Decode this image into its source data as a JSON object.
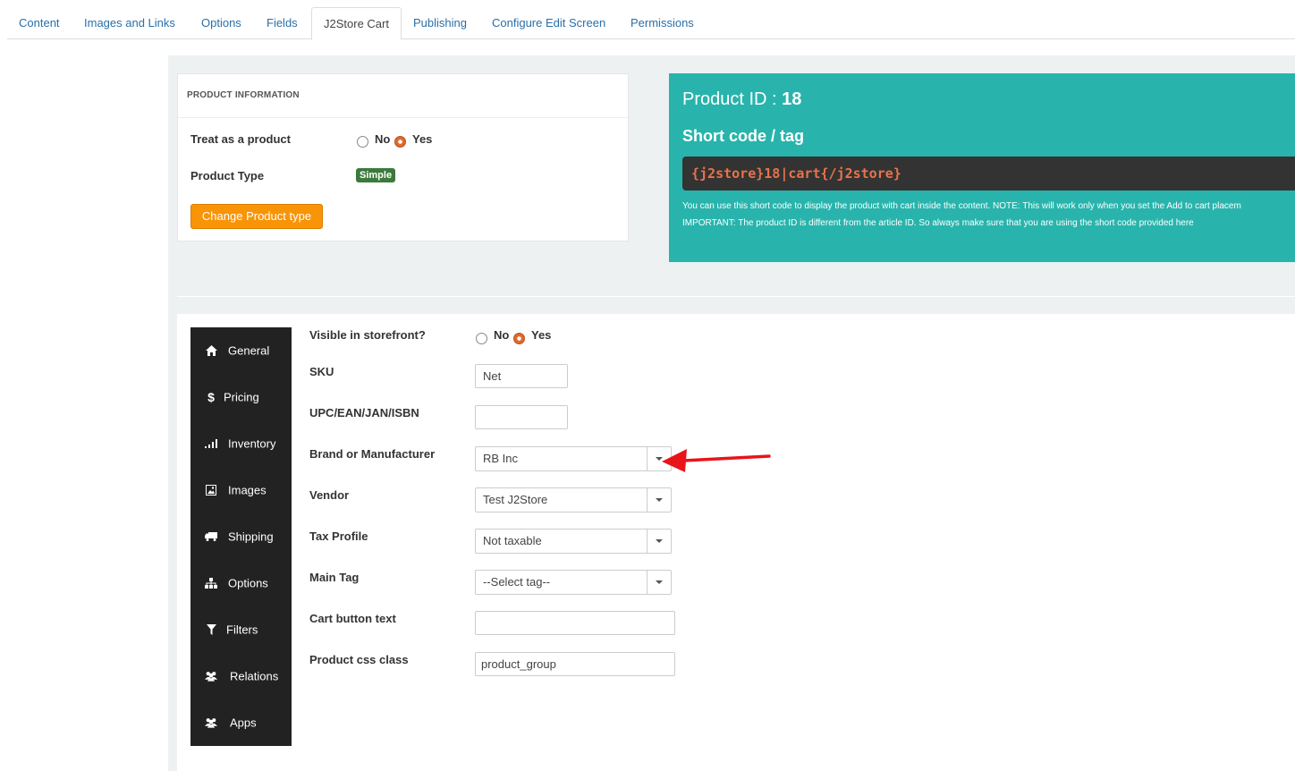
{
  "tabs": [
    "Content",
    "Images and Links",
    "Options",
    "Fields",
    "J2Store Cart",
    "Publishing",
    "Configure Edit Screen",
    "Permissions"
  ],
  "active_tab": "J2Store Cart",
  "product_info": {
    "heading": "PRODUCT INFORMATION",
    "treat_label": "Treat as a product",
    "no": "No",
    "yes": "Yes",
    "treat_value": "Yes",
    "type_label": "Product Type",
    "type_badge": "Simple",
    "change_button": "Change Product type"
  },
  "shortcode": {
    "pid_label": "Product ID : ",
    "pid_value": "18",
    "title": "Short code / tag",
    "code": "{j2store}18|cart{/j2store}",
    "note1": "You can use this short code to display the product with cart inside the content. NOTE: This will work only when you set the Add to cart placem",
    "note2": "IMPORTANT: The product ID is different from the article ID. So always make sure that you are using the short code provided here"
  },
  "sidebar": [
    {
      "label": "General",
      "icon": "home-icon",
      "glyph": "⌂"
    },
    {
      "label": "Pricing",
      "icon": "dollar-icon",
      "glyph": "$"
    },
    {
      "label": "Inventory",
      "icon": "signal-icon",
      "glyph": "▁▃▅"
    },
    {
      "label": "Images",
      "icon": "picture-icon",
      "glyph": "▣"
    },
    {
      "label": "Shipping",
      "icon": "truck-icon",
      "glyph": "▬"
    },
    {
      "label": "Options",
      "icon": "sitemap-icon",
      "glyph": "⊥"
    },
    {
      "label": "Filters",
      "icon": "filter-icon",
      "glyph": "▼"
    },
    {
      "label": "Relations",
      "icon": "users-icon",
      "glyph": "●●"
    },
    {
      "label": "Apps",
      "icon": "users-icon",
      "glyph": "●●"
    }
  ],
  "form": {
    "visible_label": "Visible in storefront?",
    "visible_value": "Yes",
    "no": "No",
    "yes": "Yes",
    "sku_label": "SKU",
    "sku_value": "Net",
    "upc_label": "UPC/EAN/JAN/ISBN",
    "upc_value": "",
    "brand_label": "Brand or Manufacturer",
    "brand_value": "RB Inc",
    "vendor_label": "Vendor",
    "vendor_value": "Test J2Store",
    "tax_label": "Tax Profile",
    "tax_value": "Not taxable",
    "tag_label": "Main Tag",
    "tag_value": "--Select tag--",
    "cart_text_label": "Cart button text",
    "cart_text_value": "",
    "css_label": "Product css class",
    "css_value": "product_group"
  },
  "colors": {
    "teal": "#28b4ac",
    "orange": "#f89406",
    "badge_green": "#3b7a3b",
    "annotation_arrow": "#e8141a"
  }
}
